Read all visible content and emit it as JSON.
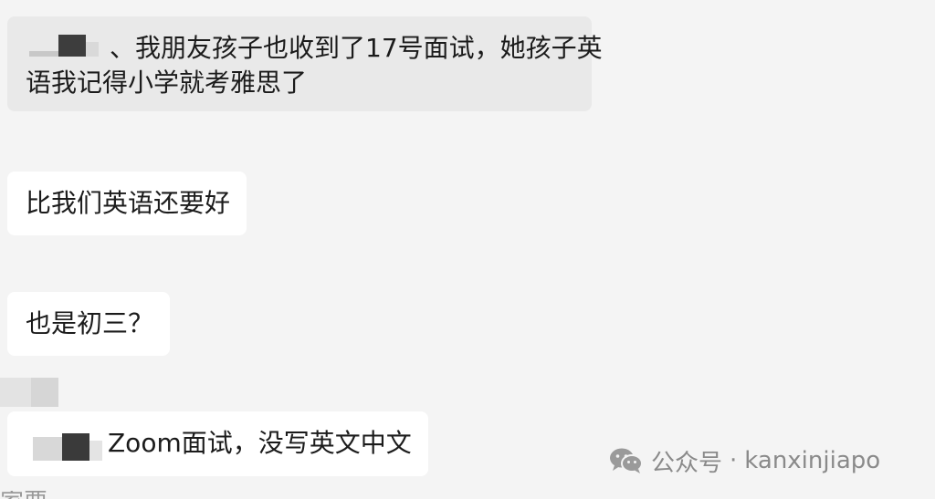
{
  "messages": [
    {
      "line1": "、我朋友孩子也收到了17号面试，她孩子英",
      "line2": "语我记得小学就考雅思了"
    },
    {
      "text": "比我们英语还要好"
    },
    {
      "text": "也是初三？"
    },
    {
      "text": "Zoom面试，没写英文中文"
    }
  ],
  "bottom_cutoff_text": "家要",
  "watermark": {
    "icon": "wechat-icon",
    "name": "公众号",
    "separator": "·",
    "account": "kanxinjiapo"
  },
  "colors": {
    "background": "#f4f4f4",
    "bubble_gray": "#e9e9e9",
    "bubble_white": "#ffffff",
    "text": "#1b1b1b",
    "watermark": "#8a8a8a"
  }
}
